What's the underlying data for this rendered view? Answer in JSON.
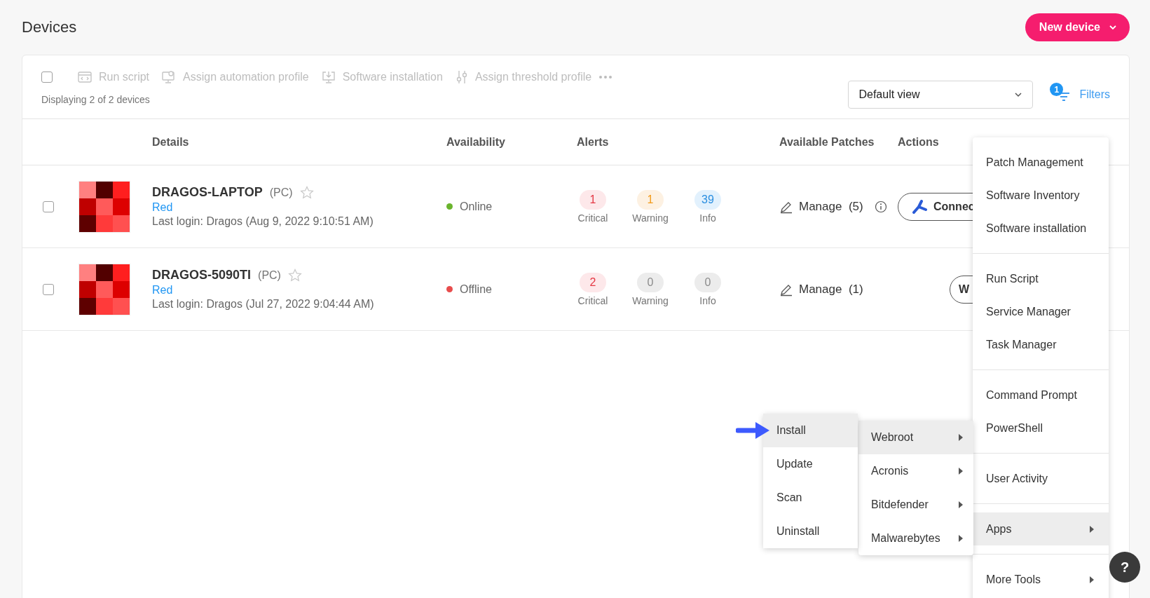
{
  "page": {
    "title": "Devices"
  },
  "new_button": {
    "label": "New device"
  },
  "toolbar": {
    "select_all": {
      "checked": false
    },
    "actions": [
      {
        "kind": "script",
        "label": "Run script",
        "disabled": true
      },
      {
        "kind": "automation",
        "label": "Assign automation profile",
        "disabled": true
      },
      {
        "kind": "install",
        "label": "Software installation",
        "disabled": true
      },
      {
        "kind": "threshold",
        "label": "Assign threshold profile",
        "disabled": true
      }
    ],
    "count_text": "Displaying 2 of 2 devices",
    "view_select": {
      "value": "Default view"
    },
    "filters": {
      "label": "Filters",
      "badge": "1"
    }
  },
  "table": {
    "columns": [
      "Details",
      "Availability",
      "Alerts",
      "Available Patches",
      "Actions"
    ],
    "rows": [
      {
        "checked": false,
        "name": "DRAGOS-LAPTOP",
        "type": "(PC)",
        "starred": false,
        "group": "Red",
        "last_login": "Last login: Dragos (Aug 9, 2022 9:10:51 AM)",
        "status": "Online",
        "color": "#6ab42d",
        "alerts": [
          {
            "kind": "critical",
            "count": "1",
            "label": "Critical"
          },
          {
            "kind": "warning",
            "count": "1",
            "label": "Warning"
          },
          {
            "kind": "info",
            "count": "39",
            "label": "Info"
          }
        ],
        "patches": {
          "label": "Manage",
          "count": "(5)",
          "info_icon": true
        },
        "action": {
          "kind": "connect",
          "label": "Connec"
        }
      },
      {
        "checked": false,
        "name": "DRAGOS-5090TI",
        "type": "(PC)",
        "starred": false,
        "group": "Red",
        "last_login": "Last login: Dragos (Jul 27, 2022 9:04:44 AM)",
        "status": "Offline",
        "color": "#e84c4c",
        "alerts": [
          {
            "kind": "critical",
            "count": "2",
            "label": "Critical"
          },
          {
            "kind": "none",
            "count": "0",
            "label": "Warning"
          },
          {
            "kind": "none",
            "count": "0",
            "label": "Info"
          }
        ],
        "patches": {
          "label": "Manage",
          "count": "(1)",
          "info_icon": false
        },
        "action": {
          "kind": "plain",
          "label": "W"
        }
      }
    ]
  },
  "context_menu": {
    "groups": [
      [
        {
          "label": "Patch Management",
          "submenu": false,
          "selected": false
        },
        {
          "label": "Software Inventory",
          "submenu": false,
          "selected": false
        },
        {
          "label": "Software installation",
          "submenu": false,
          "selected": false
        }
      ],
      [
        {
          "label": "Run Script",
          "submenu": false,
          "selected": false
        },
        {
          "label": "Service Manager",
          "submenu": false,
          "selected": false
        },
        {
          "label": "Task Manager",
          "submenu": false,
          "selected": false
        }
      ],
      [
        {
          "label": "Command Prompt",
          "submenu": false,
          "selected": false
        },
        {
          "label": "PowerShell",
          "submenu": false,
          "selected": false
        }
      ],
      [
        {
          "label": "User Activity",
          "submenu": false,
          "selected": false
        }
      ],
      [
        {
          "label": "Apps",
          "submenu": true,
          "selected": true
        }
      ],
      [
        {
          "label": "More Tools",
          "submenu": true,
          "selected": false
        }
      ]
    ]
  },
  "apps_menu": {
    "items": [
      {
        "label": "Webroot",
        "submenu": true,
        "selected": true
      },
      {
        "label": "Acronis",
        "submenu": true,
        "selected": false
      },
      {
        "label": "Bitdefender",
        "submenu": true,
        "selected": false
      },
      {
        "label": "Malwarebytes",
        "submenu": true,
        "selected": false
      }
    ]
  },
  "action_menu": {
    "items": [
      {
        "label": "Install",
        "selected": true
      },
      {
        "label": "Update",
        "selected": false
      },
      {
        "label": "Scan",
        "selected": false
      },
      {
        "label": "Uninstall",
        "selected": false
      }
    ]
  },
  "help": {
    "label": "?"
  }
}
